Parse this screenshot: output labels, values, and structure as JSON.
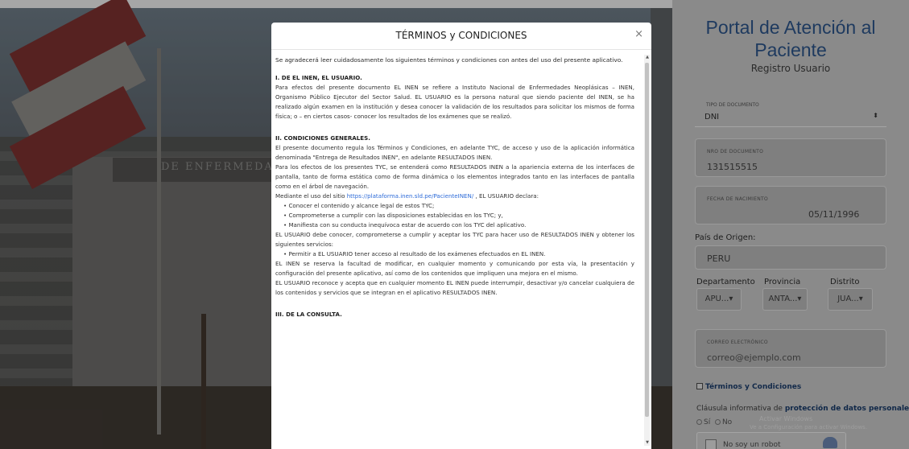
{
  "background": {
    "banner_text": "DE ENFERMEDADES N"
  },
  "panel": {
    "title": "Portal de Atención al Paciente",
    "subtitle": "Registro Usuario",
    "doc_type": {
      "label": "TIPO DE DOCUMENTO",
      "value": "DNI"
    },
    "doc_number": {
      "label": "NRO DE DOCUMENTO",
      "value": "131515515"
    },
    "birth_date": {
      "label": "FECHA DE NACIMIENTO",
      "value": "05/11/1996"
    },
    "country": {
      "label": "País de Origen:",
      "value": "PERU"
    },
    "location": {
      "dept_label": "Departamento",
      "prov_label": "Provincia",
      "dist_label": "Distrito",
      "dept_value": "APU...",
      "prov_value": "ANTA...",
      "dist_value": "JUA..."
    },
    "email": {
      "label": "CORREO ELECTRÓNICO",
      "placeholder": "correo@ejemplo.com"
    },
    "terms_label": "Términos y Condiciones",
    "clause_prefix": "Cláusula informativa de ",
    "clause_link": "protección de datos personales",
    "radio_yes": "Sí",
    "radio_no": "No",
    "watermark_title": "Activar Windows",
    "watermark_sub": "Ve a Configuración para activar Windows.",
    "captcha_label": "No soy un robot"
  },
  "modal": {
    "title": "TÉRMINOS y CONDICIONES",
    "close": "×",
    "intro": "Se agradecerá leer cuidadosamente los siguientes términos y condiciones con antes del uso del presente aplicativo.",
    "sec1_title": "I. DE EL INEN, EL USUARIO.",
    "sec1_text": "Para efectos del presente documento EL INEN se refiere a Instituto Nacional de Enfermedades Neoplásicas – INEN, Organismo Público Ejecutor del Sector Salud. EL USUARIO es la persona natural que siendo paciente del INEN, se ha realizado algún examen en la institución y desea conocer la validación de los resultados para solicitar los mismos de forma física; o – en ciertos casos- conocer los resultados de los exámenes que se realizó.",
    "sec2_title": "II. CONDICIONES GENERALES.",
    "sec2_p1": "El presente documento regula los Términos y Condiciones, en adelante TYC, de acceso y uso de la aplicación informática denominada \"Entrega de Resultados INEN\", en adelante RESULTADOS INEN.",
    "sec2_p2": "Para los efectos de los presentes TYC, se entenderá como RESULTADOS INEN a la apariencia externa de los interfaces de pantalla, tanto de forma estática como de forma dinámica o los elementos integrados tanto en las interfaces de pantalla como en el árbol de navegación.",
    "sec2_p3_pre": "Mediante el uso del sitio ",
    "sec2_p3_link": "https://plataforma.inen.sld.pe/PacienteINEN/",
    "sec2_p3_post": " , EL USUARIO declara:",
    "bullet1": "• Conocer el contenido y alcance legal de estos TYC;",
    "bullet2": "• Comprometerse a cumplir con las disposiciones establecidas en los TYC; y,",
    "bullet3": "• Manifiesta con su conducta inequívoca estar de acuerdo con los TYC del aplicativo.",
    "sec2_p4": "EL USUARIO debe conocer, comprometerse a cumplir y aceptar los TYC para hacer uso de RESULTADOS INEN y obtener los siguientes servicios:",
    "bullet4": "• Permitir a EL USUARIO tener acceso al resultado de los exámenes efectuados en EL INEN.",
    "sec2_p5": "EL INEN se reserva la facultad de modificar, en cualquier momento y comunicando por esta vía, la presentación y configuración del presente aplicativo, así como de los contenidos que impliquen una mejora en el mismo.",
    "sec2_p6": "EL USUARIO reconoce y acepta que en cualquier momento EL INEN puede interrumpir, desactivar y/o cancelar cualquiera de los contenidos y servicios que se integran en el aplicativo RESULTADOS INEN.",
    "sec3_title": "III. DE LA CONSULTA."
  }
}
